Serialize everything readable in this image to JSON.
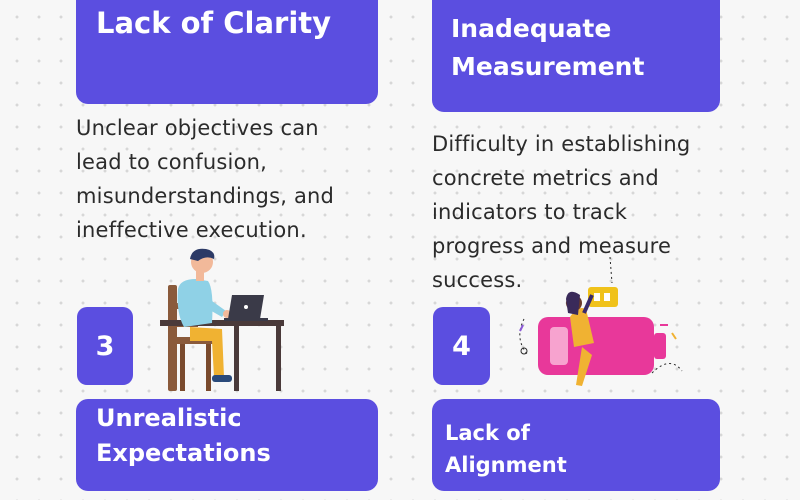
{
  "cards": {
    "card1": {
      "title": "Lack of Clarity"
    },
    "card2": {
      "title_line1": "Inadequate",
      "title_line2": "Measurement"
    },
    "card3": {
      "number": "3",
      "title_line1": "Unrealistic",
      "title_line2": "Expectations"
    },
    "card4": {
      "number": "4",
      "title_line1": "Lack of",
      "title_line2": "Alignment"
    }
  },
  "descriptions": {
    "desc1": [
      "Unclear objectives can",
      "lead to confusion,",
      "misunderstandings, and",
      "ineffective execution."
    ],
    "desc2": [
      "Difficulty in establishing",
      "concrete metrics and",
      "indicators to track",
      "progress and measure",
      "success."
    ]
  },
  "colors": {
    "card": "#5b4ee0",
    "text": "#2b2b2b",
    "battery": "#e8389a",
    "background": "#f7f7f7"
  },
  "illustrations": {
    "left": "person-at-laptop-desk",
    "right": "person-with-battery"
  }
}
